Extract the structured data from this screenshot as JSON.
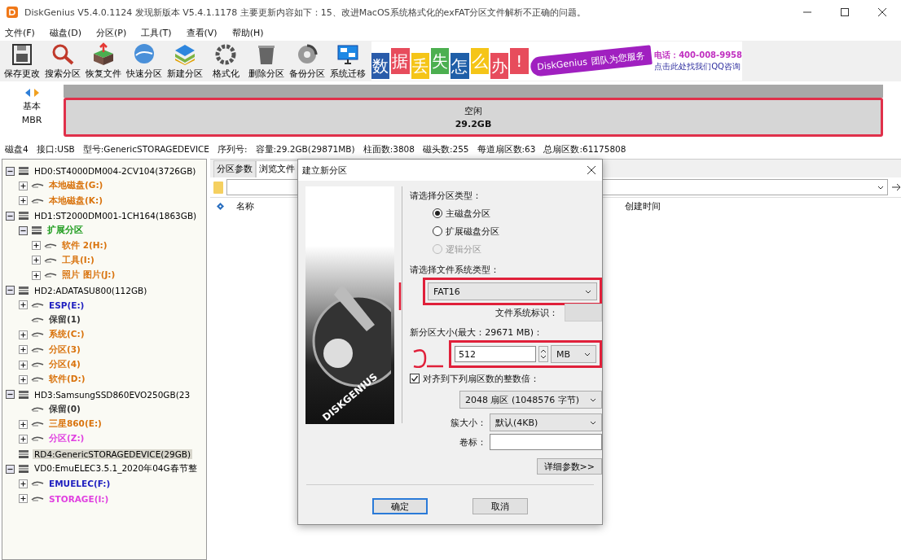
{
  "window": {
    "title": "DiskGenius V5.4.0.1124   发现新版本 V5.4.1.1178 主要更新内容如下：15、改进MacOS系统格式化的exFAT分区文件解析不正确的问题。"
  },
  "menu": [
    "文件(F)",
    "磁盘(D)",
    "分区(P)",
    "工具(T)",
    "查看(V)",
    "帮助(H)"
  ],
  "toolbar": [
    "保存更改",
    "搜索分区",
    "恢复文件",
    "快速分区",
    "新建分区",
    "格式化",
    "删除分区",
    "备份分区",
    "系统迁移"
  ],
  "banner": {
    "tiles": [
      "数",
      "据",
      "丢",
      "失",
      "怎",
      "么",
      "办",
      "!"
    ],
    "brand": "DiskGenius",
    "slogan": "团队为您服务",
    "phone": "电话：400-008-9958",
    "qq": "点击此处找我们QQ咨询"
  },
  "disk_map": {
    "type": "基本",
    "scheme": "MBR",
    "partition_label": "空闲",
    "partition_size": "29.2GB",
    "annotated": true
  },
  "disk_info": [
    "磁盘4",
    "接口:USB",
    "型号:GenericSTORAGEDEVICE",
    "序列号:",
    "容量:29.2GB(29871MB)",
    "柱面数:3808",
    "磁头数:255",
    "每道扇区数:63",
    "总扇区数:61175808"
  ],
  "tree": {
    "items": [
      {
        "kind": "disk",
        "label": "HD0:ST4000DM004-2CV104(3726GB)",
        "color": "#000000",
        "expandable": true,
        "expanded": true,
        "selected": false,
        "children": [
          {
            "kind": "partition",
            "label": "本地磁盘(G:)",
            "color": "#d9730d",
            "expandable": true,
            "expanded": false,
            "selected": false
          },
          {
            "kind": "partition",
            "label": "本地磁盘(K:)",
            "color": "#d9730d",
            "expandable": true,
            "expanded": false,
            "selected": false
          }
        ]
      },
      {
        "kind": "disk",
        "label": "HD1:ST2000DM001-1CH164(1863GB)",
        "color": "#000000",
        "expandable": true,
        "expanded": true,
        "selected": false,
        "children": [
          {
            "kind": "disk",
            "label": "扩展分区",
            "color": "#1a9a1a",
            "expandable": true,
            "expanded": true,
            "selected": false,
            "children": [
              {
                "kind": "partition",
                "label": "软件 2(H:)",
                "color": "#d9730d",
                "expandable": true,
                "expanded": false,
                "selected": false
              },
              {
                "kind": "partition",
                "label": "工具(I:)",
                "color": "#d9730d",
                "expandable": true,
                "expanded": false,
                "selected": false
              },
              {
                "kind": "partition",
                "label": "照片 图片(J:)",
                "color": "#d9730d",
                "expandable": true,
                "expanded": false,
                "selected": false
              }
            ]
          }
        ]
      },
      {
        "kind": "disk",
        "label": "HD2:ADATASU800(112GB)",
        "color": "#000000",
        "expandable": true,
        "expanded": true,
        "selected": false,
        "children": [
          {
            "kind": "partition",
            "label": "ESP(E:)",
            "color": "#2020c0",
            "expandable": true,
            "expanded": false,
            "selected": false
          },
          {
            "kind": "partition",
            "label": "保留(1)",
            "color": "#333333",
            "expandable": false,
            "selected": false
          },
          {
            "kind": "partition",
            "label": "系统(C:)",
            "color": "#d9730d",
            "expandable": true,
            "expanded": false,
            "selected": false
          },
          {
            "kind": "partition",
            "label": "分区(3)",
            "color": "#d9730d",
            "expandable": true,
            "expanded": false,
            "selected": false
          },
          {
            "kind": "partition",
            "label": "分区(4)",
            "color": "#d9730d",
            "expandable": true,
            "expanded": false,
            "selected": false
          },
          {
            "kind": "partition",
            "label": "软件(D:)",
            "color": "#d9730d",
            "expandable": true,
            "expanded": false,
            "selected": false
          }
        ]
      },
      {
        "kind": "disk",
        "label": "HD3:SamsungSSD860EVO250GB(23",
        "color": "#000000",
        "expandable": true,
        "expanded": true,
        "selected": false,
        "children": [
          {
            "kind": "partition",
            "label": "保留(0)",
            "color": "#333333",
            "expandable": false,
            "selected": false
          },
          {
            "kind": "partition",
            "label": "三星860(E:)",
            "color": "#d9730d",
            "expandable": true,
            "expanded": false,
            "selected": false
          },
          {
            "kind": "partition",
            "label": "分区(Z:)",
            "color": "#e040e0",
            "expandable": true,
            "expanded": false,
            "selected": false
          }
        ]
      },
      {
        "kind": "disk",
        "label": "RD4:GenericSTORAGEDEVICE(29GB)",
        "color": "#000000",
        "expandable": false,
        "selected": true
      },
      {
        "kind": "disk",
        "label": "VD0:EmuELEC3.5.1_2020年04G春节整",
        "color": "#000000",
        "expandable": true,
        "expanded": true,
        "selected": false,
        "children": [
          {
            "kind": "partition",
            "label": "EMUELEC(F:)",
            "color": "#2020c0",
            "expandable": true,
            "expanded": false,
            "selected": false
          },
          {
            "kind": "partition",
            "label": "STORAGE(I:)",
            "color": "#e040e0",
            "expandable": true,
            "expanded": false,
            "selected": false
          }
        ]
      }
    ]
  },
  "browser": {
    "tabs": [
      {
        "label": "分区参数",
        "selected": false
      },
      {
        "label": "浏览文件",
        "selected": true
      }
    ],
    "columns": [
      "名称",
      "创建时间"
    ]
  },
  "dialog": {
    "title": "建立新分区",
    "image_label": "DISKGENIUS",
    "type_label": "请选择分区类型：",
    "types": [
      {
        "label": "主磁盘分区",
        "selected": true,
        "disabled": false
      },
      {
        "label": "扩展磁盘分区",
        "selected": false,
        "disabled": false
      },
      {
        "label": "逻辑分区",
        "selected": false,
        "disabled": true
      }
    ],
    "fs_label": "请选择文件系统类型：",
    "fs_value": "FAT16",
    "fs_annotated": true,
    "fs_id_label": "文件系统标识：",
    "size_label": "新分区大小(最大：29671 MB)：",
    "size_value": "512",
    "size_unit": "MB",
    "size_annotated": true,
    "align": {
      "checked": true,
      "label": "对齐到下列扇区数的整数倍：",
      "value": "2048 扇区 (1048576 字节)"
    },
    "cluster_label": "簇大小：",
    "cluster_value": "默认(4KB)",
    "volume_label": "卷标：",
    "advanced_button": "详细参数>>",
    "ok": "确定",
    "cancel": "取消"
  }
}
